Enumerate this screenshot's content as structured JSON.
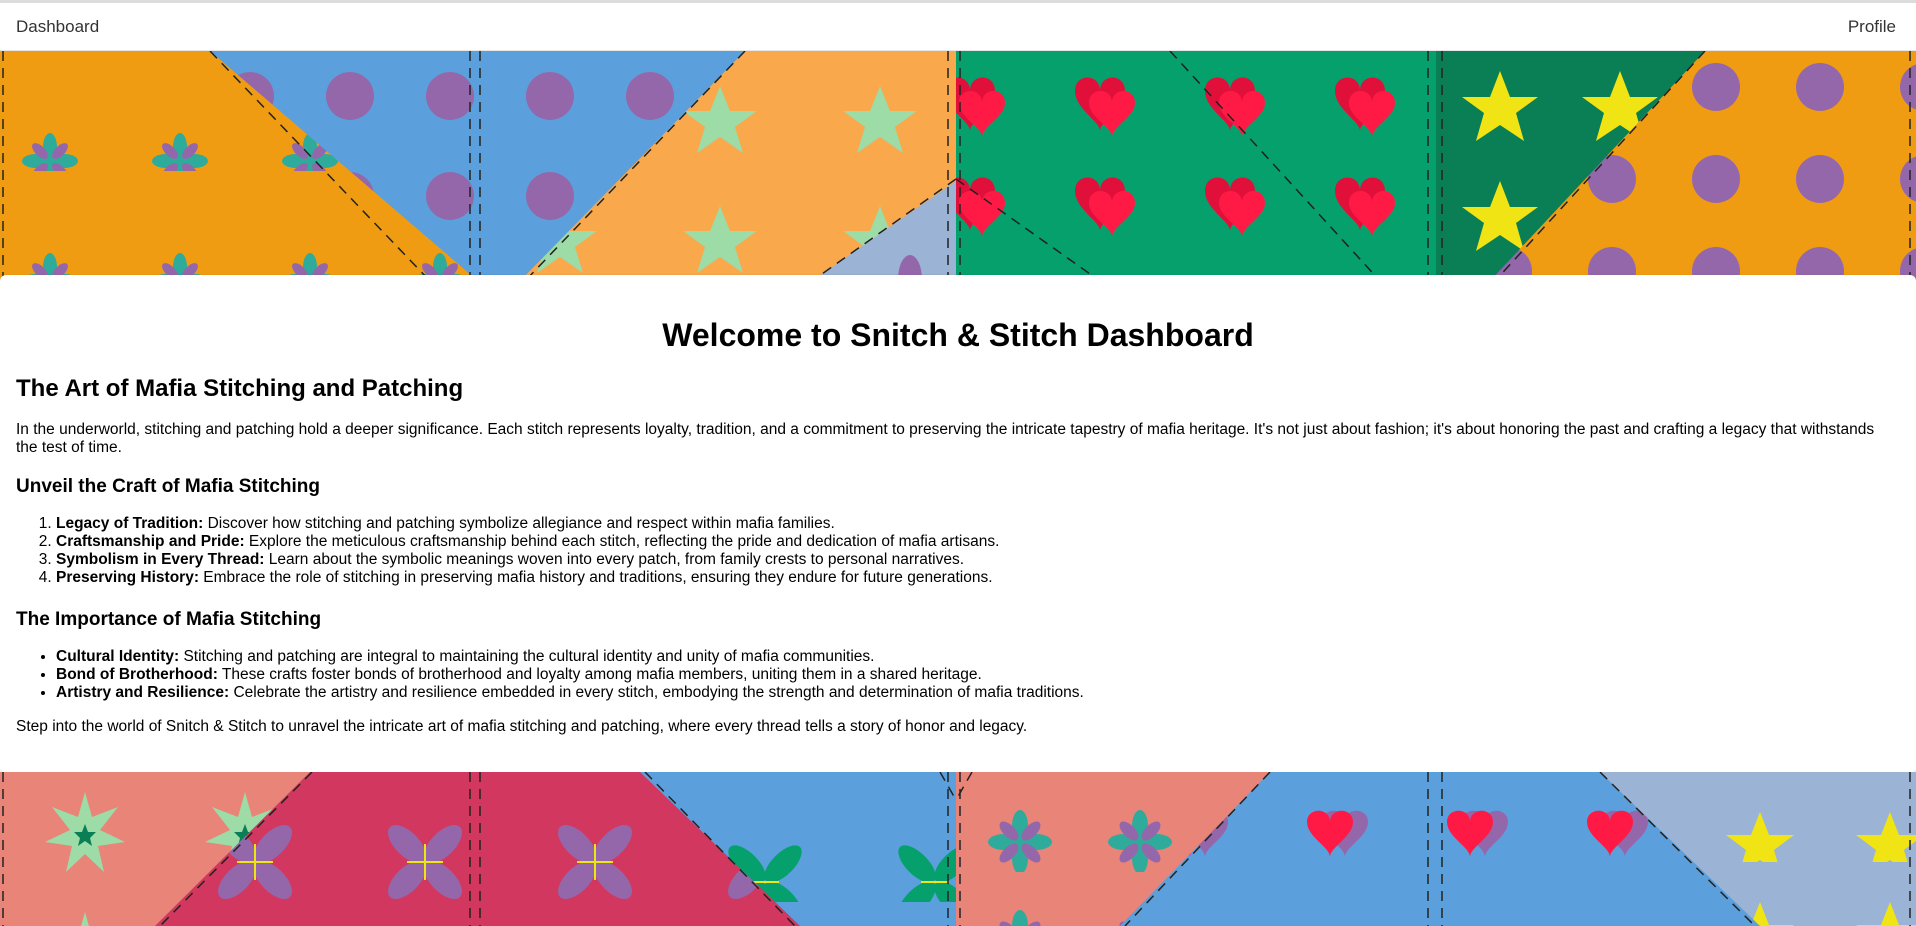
{
  "nav": {
    "dashboard_label": "Dashboard",
    "profile_label": "Profile"
  },
  "main": {
    "title": "Welcome to Snitch & Stitch Dashboard",
    "subtitle": "The Art of Mafia Stitching and Patching",
    "intro": "In the underworld, stitching and patching hold a deeper significance. Each stitch represents loyalty, tradition, and a commitment to preserving the intricate tapestry of mafia heritage. It's not just about fashion; it's about honoring the past and crafting a legacy that withstands the test of time.",
    "craft_heading": "Unveil the Craft of Mafia Stitching",
    "craft_items": [
      {
        "term": "Legacy of Tradition:",
        "text": " Discover how stitching and patching symbolize allegiance and respect within mafia families."
      },
      {
        "term": "Craftsmanship and Pride:",
        "text": " Explore the meticulous craftsmanship behind each stitch, reflecting the pride and dedication of mafia artisans."
      },
      {
        "term": "Symbolism in Every Thread:",
        "text": " Learn about the symbolic meanings woven into every patch, from family crests to personal narratives."
      },
      {
        "term": "Preserving History:",
        "text": " Embrace the role of stitching in preserving mafia history and traditions, ensuring they endure for future generations."
      }
    ],
    "importance_heading": "The Importance of Mafia Stitching",
    "importance_items": [
      {
        "term": "Cultural Identity:",
        "text": " Stitching and patching are integral to maintaining the cultural identity and unity of mafia communities."
      },
      {
        "term": "Bond of Brotherhood:",
        "text": " These crafts foster bonds of brotherhood and loyalty among mafia members, uniting them in a shared heritage."
      },
      {
        "term": "Artistry and Resilience:",
        "text": " Celebrate the artistry and resilience embedded in every stitch, embodying the strength and determination of mafia traditions."
      }
    ],
    "closing": "Step into the world of Snitch & Stitch to unravel the intricate art of mafia stitching and patching, where every thread tells a story of honor and legacy."
  },
  "colors": {
    "orange": "#f09c13",
    "blue": "#5b9fdc",
    "light_orange": "#f9a84c",
    "grey_blue": "#9bb3d4",
    "green": "#05a06c",
    "dark_green": "#0a7f55",
    "salmon": "#e98478",
    "raspberry": "#d1375f",
    "purple": "#9467ab",
    "teal": "#2eab9b",
    "red": "#f0103a",
    "yellow": "#f1e414",
    "mint": "#9ddba7"
  }
}
